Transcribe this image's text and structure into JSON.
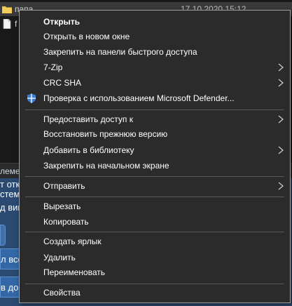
{
  "explorer": {
    "files": [
      {
        "name": "папа",
        "date": "17.10.2020 15:12",
        "type": "folder"
      },
      {
        "name": "f",
        "date": "",
        "type": "file"
      }
    ]
  },
  "background_fragments": {
    "status_text": "лемен",
    "line1": "т отк",
    "line2": "стем",
    "line3": "д вин",
    "btn2": "л все",
    "btn3": "в до"
  },
  "context_menu": {
    "items": [
      {
        "label": "Открыть",
        "bold": true
      },
      {
        "label": "Открыть в новом окне"
      },
      {
        "label": "Закрепить на панели быстрого доступа"
      },
      {
        "label": "7-Zip",
        "submenu": true
      },
      {
        "label": "CRC SHA",
        "submenu": true
      },
      {
        "label": "Проверка с использованием Microsoft Defender...",
        "icon": "defender-shield-icon"
      },
      {
        "label": "Предоставить доступ к",
        "submenu": true
      },
      {
        "label": "Восстановить прежнюю версию"
      },
      {
        "label": "Добавить в библиотеку",
        "submenu": true
      },
      {
        "label": "Закрепить на начальном экране"
      },
      {
        "label": "Отправить",
        "submenu": true
      },
      {
        "label": "Вырезать"
      },
      {
        "label": "Копировать"
      },
      {
        "label": "Создать ярлык"
      },
      {
        "label": "Удалить"
      },
      {
        "label": "Переименовать"
      },
      {
        "label": "Свойства"
      }
    ]
  },
  "colors": {
    "menu_bg": "#2b2b2b",
    "menu_border": "#a0a0a0",
    "menu_text": "#ffffff",
    "separator": "#5a5a5a",
    "background_blue": "#2a4a72",
    "folder": "#e8c04a",
    "defender_blue": "#3a7fd5"
  }
}
